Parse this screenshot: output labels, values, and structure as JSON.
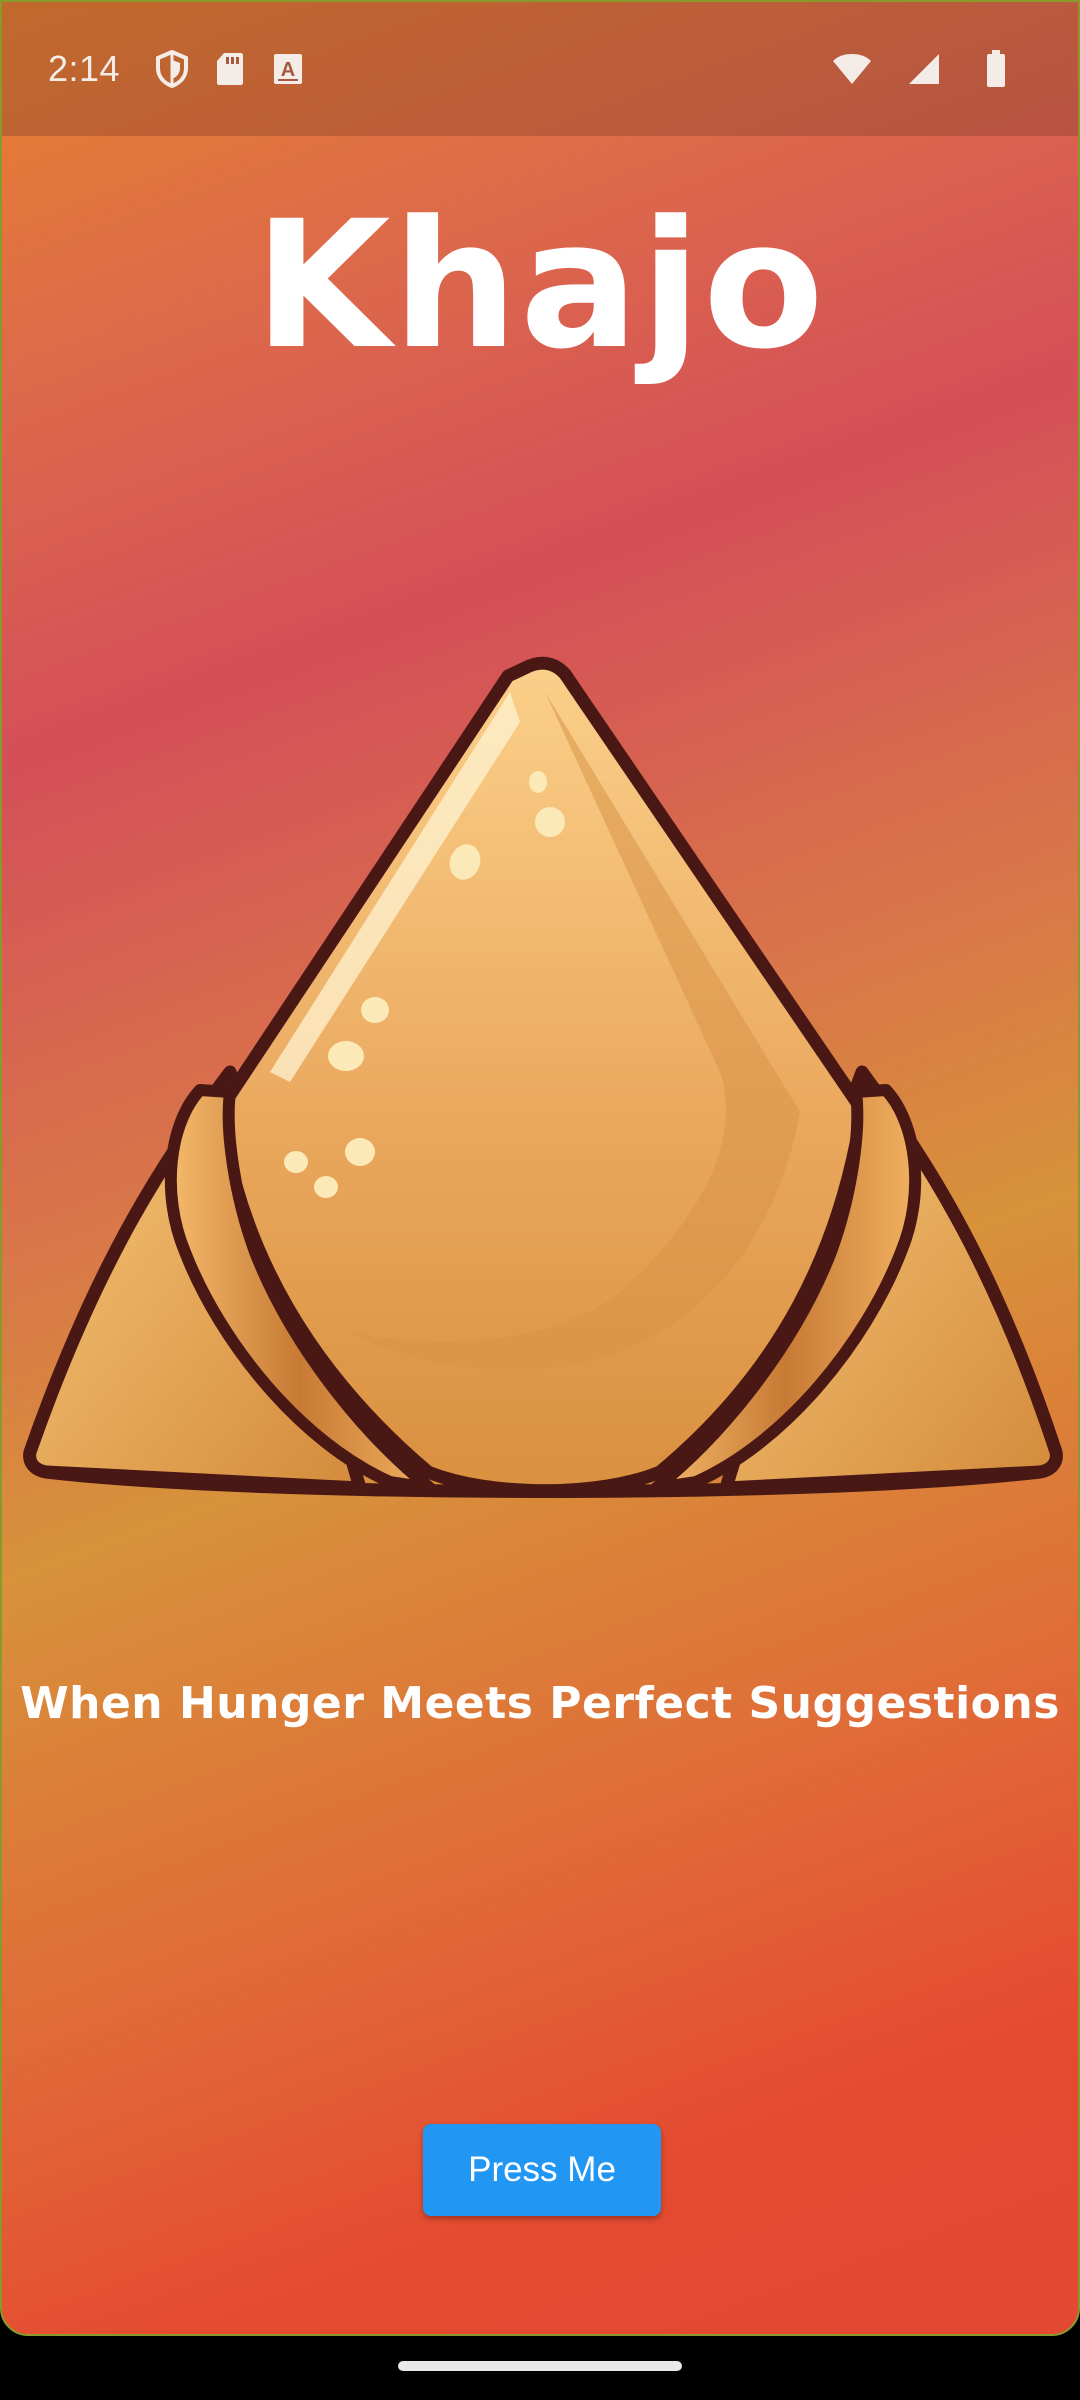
{
  "status_bar": {
    "time": "2:14",
    "left_icons": [
      "shield-icon",
      "sd-card-icon",
      "a-box-icon"
    ],
    "right_icons": [
      "wifi-icon",
      "signal-icon",
      "battery-icon"
    ]
  },
  "app": {
    "title": "Khajo",
    "illustration": "samosa-illustration",
    "tagline": "When Hunger Meets Perfect Suggestions",
    "button_label": "Press Me",
    "button_color": "#2196f3"
  },
  "colors": {
    "background_gradient": [
      "#e8822e",
      "#d44f58",
      "#d7923a",
      "#e24832"
    ],
    "title_text": "#ffffff"
  }
}
